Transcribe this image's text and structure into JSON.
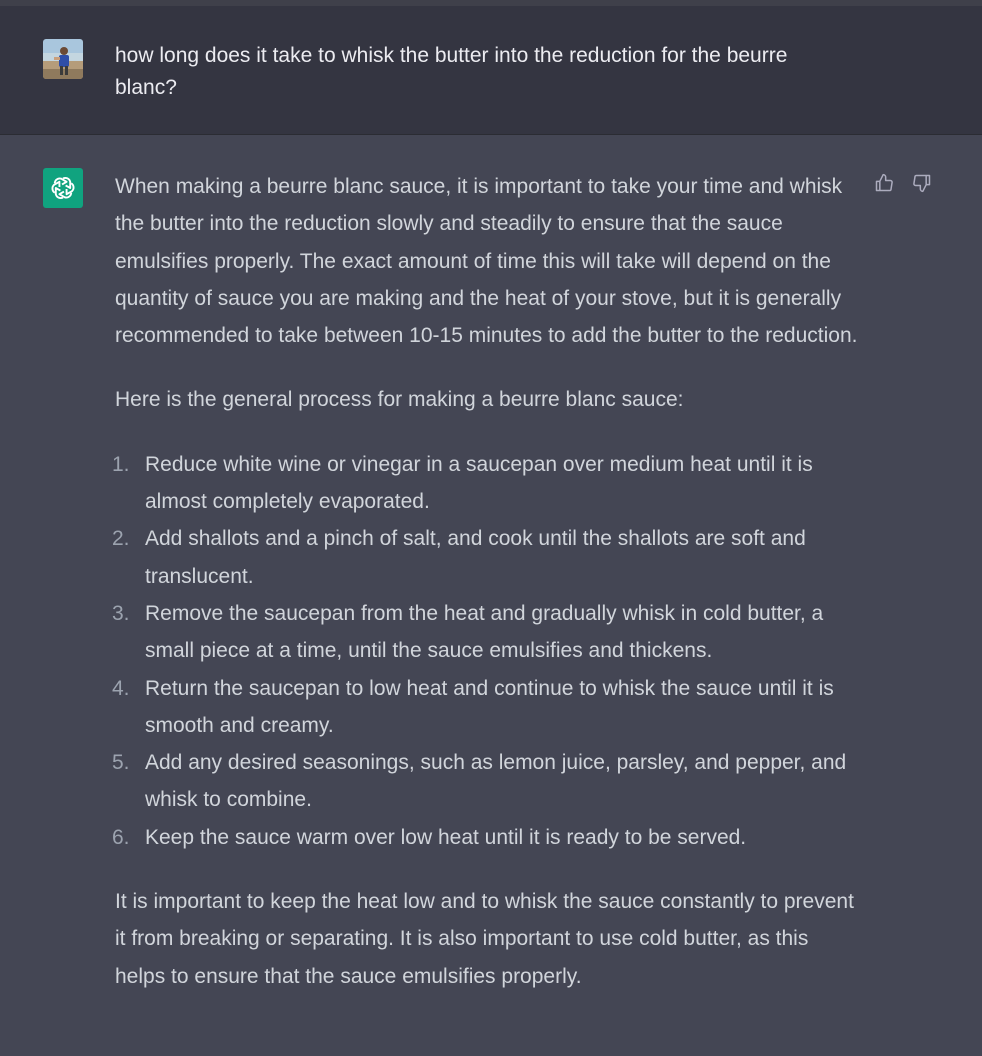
{
  "user_message": {
    "text": "how long does it take to whisk the butter into the reduction for the beurre blanc?"
  },
  "assistant_message": {
    "intro": "When making a beurre blanc sauce, it is important to take your time and whisk the butter into the reduction slowly and steadily to ensure that the sauce emulsifies properly. The exact amount of time this will take will depend on the quantity of sauce you are making and the heat of your stove, but it is generally recommended to take between 10-15 minutes to add the butter to the reduction.",
    "process_heading": "Here is the general process for making a beurre blanc sauce:",
    "steps": [
      {
        "num": "1.",
        "text": "Reduce white wine or vinegar in a saucepan over medium heat until it is almost completely evaporated."
      },
      {
        "num": "2.",
        "text": "Add shallots and a pinch of salt, and cook until the shallots are soft and translucent."
      },
      {
        "num": "3.",
        "text": "Remove the saucepan from the heat and gradually whisk in cold butter, a small piece at a time, until the sauce emulsifies and thickens."
      },
      {
        "num": "4.",
        "text": "Return the saucepan to low heat and continue to whisk the sauce until it is smooth and creamy."
      },
      {
        "num": "5.",
        "text": "Add any desired seasonings, such as lemon juice, parsley, and pepper, and whisk to combine."
      },
      {
        "num": "6.",
        "text": "Keep the sauce warm over low heat until it is ready to be served."
      }
    ],
    "conclusion": "It is important to keep the heat low and to whisk the sauce constantly to prevent it from breaking or separating. It is also important to use cold butter, as this helps to ensure that the sauce emulsifies properly."
  },
  "icons": {
    "assistant_avatar": "openai-logo-icon",
    "thumbs_up": "thumbs-up-icon",
    "thumbs_down": "thumbs-down-icon"
  },
  "colors": {
    "user_bg": "#343541",
    "assistant_bg": "#444654",
    "assistant_avatar_bg": "#10a37f",
    "user_text": "#ececf1",
    "assistant_text": "#d1d5db"
  }
}
